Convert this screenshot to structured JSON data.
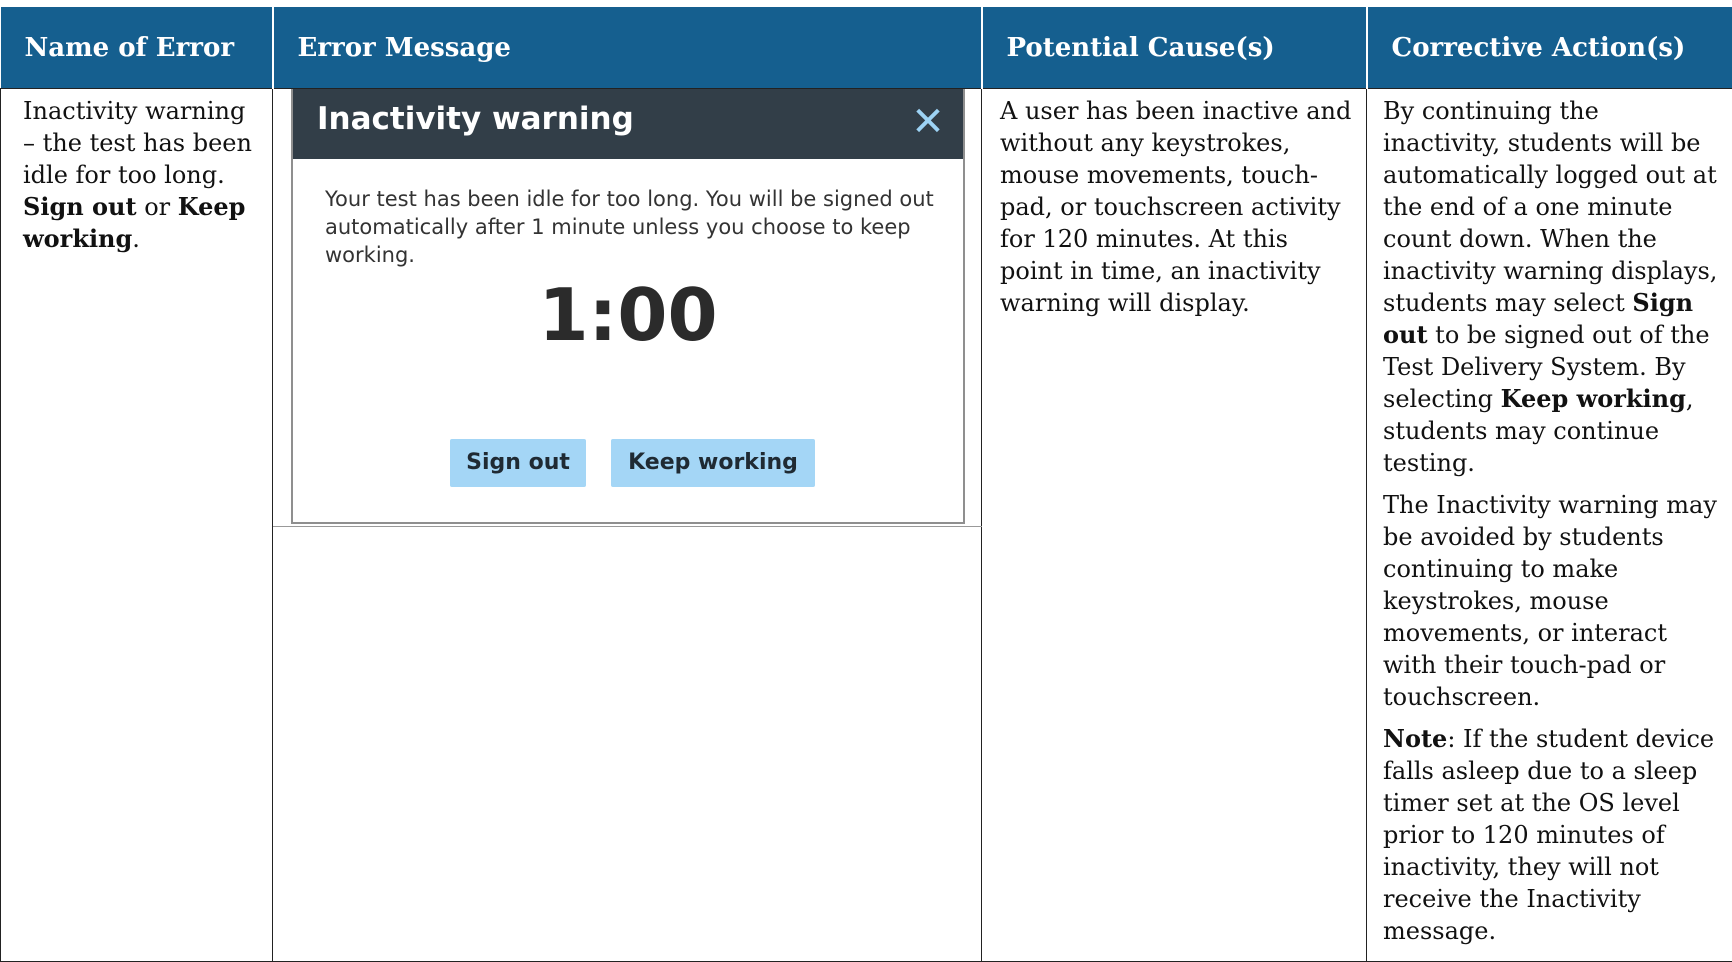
{
  "headers": {
    "name": "Name of Error",
    "message": "Error Message",
    "cause": "Potential Cause(s)",
    "action": "Corrective Action(s)"
  },
  "name_cell": {
    "line1": "Inactivity warning – the test has been idle for too long. ",
    "sign_out": "Sign out",
    "or": " or ",
    "keep_working": "Keep working",
    "period": "."
  },
  "dialog": {
    "title": "Inactivity warning",
    "close_icon": "close-icon",
    "message": "Your test has been idle for too long. You will be signed out automatically after 1 minute unless you choose to keep working.",
    "timer": "1:00",
    "sign_out_label": "Sign out",
    "keep_working_label": "Keep working",
    "colors": {
      "header": "#323e48",
      "close": "#9dd3f5",
      "button": "#a4d6f6"
    }
  },
  "cause_text": "A user has been inactive and without any keystrokes, mouse movements, touch-pad, or touchscreen activity for 120 minutes. At this point in time, an inactivity warning will display.",
  "action": {
    "p1_a": "By continuing the inactivity, students will be automatically logged out at the end of a one minute count down. When the inactivity warning displays, students may select ",
    "p1_b": "Sign out",
    "p1_c": " to be signed out of the Test Delivery System. By selecting ",
    "p1_d": "Keep working",
    "p1_e": ", students may continue testing.",
    "p2": "The Inactivity warning may be avoided by students continuing to make keystrokes, mouse movements, or interact with their touch-pad or touchscreen.",
    "p3_note": "Note",
    "p3_rest": ": If the student device falls asleep due to a sleep timer set at the OS level prior to 120 minutes of inactivity, they will not receive the Inactivity message."
  },
  "header_color": "#155f8f"
}
